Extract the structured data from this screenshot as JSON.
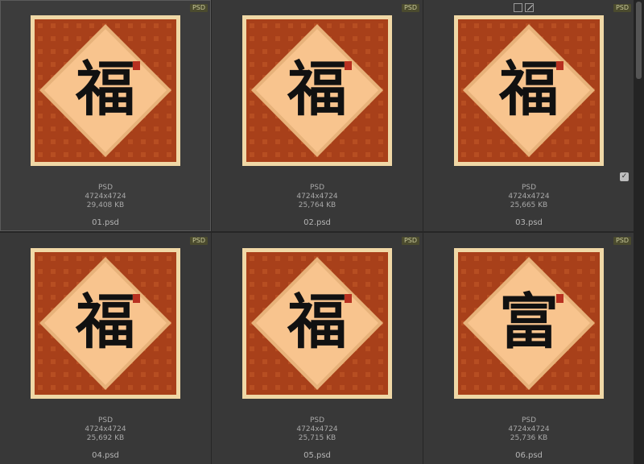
{
  "colors": {
    "background": "#2b2b2b",
    "cell": "#383838",
    "frame": "#f0d8a6",
    "pattern": "#a8401a",
    "diamond": "#f8c48e",
    "ink": "#111111",
    "seal": "#b83020"
  },
  "items": [
    {
      "badge": "PSD",
      "type": "PSD",
      "dims": "4724x4724",
      "size": "29,408 KB",
      "filename": "01.psd",
      "glyph": "福",
      "selected": true
    },
    {
      "badge": "PSD",
      "type": "PSD",
      "dims": "4724x4724",
      "size": "25,764 KB",
      "filename": "02.psd",
      "glyph": "福",
      "selected": false
    },
    {
      "badge": "PSD",
      "type": "PSD",
      "dims": "4724x4724",
      "size": "25,665 KB",
      "filename": "03.psd",
      "glyph": "福",
      "selected": false
    },
    {
      "badge": "PSD",
      "type": "PSD",
      "dims": "4724x4724",
      "size": "25,692 KB",
      "filename": "04.psd",
      "glyph": "福",
      "selected": false
    },
    {
      "badge": "PSD",
      "type": "PSD",
      "dims": "4724x4724",
      "size": "25,715 KB",
      "filename": "05.psd",
      "glyph": "福",
      "selected": false
    },
    {
      "badge": "PSD",
      "type": "PSD",
      "dims": "4724x4724",
      "size": "25,736 KB",
      "filename": "06.psd",
      "glyph": "富",
      "selected": false
    }
  ],
  "icons": {
    "frame_toggle": "square-icon",
    "edit_tool": "pencil-icon",
    "checkbox": "checkmark-icon"
  }
}
